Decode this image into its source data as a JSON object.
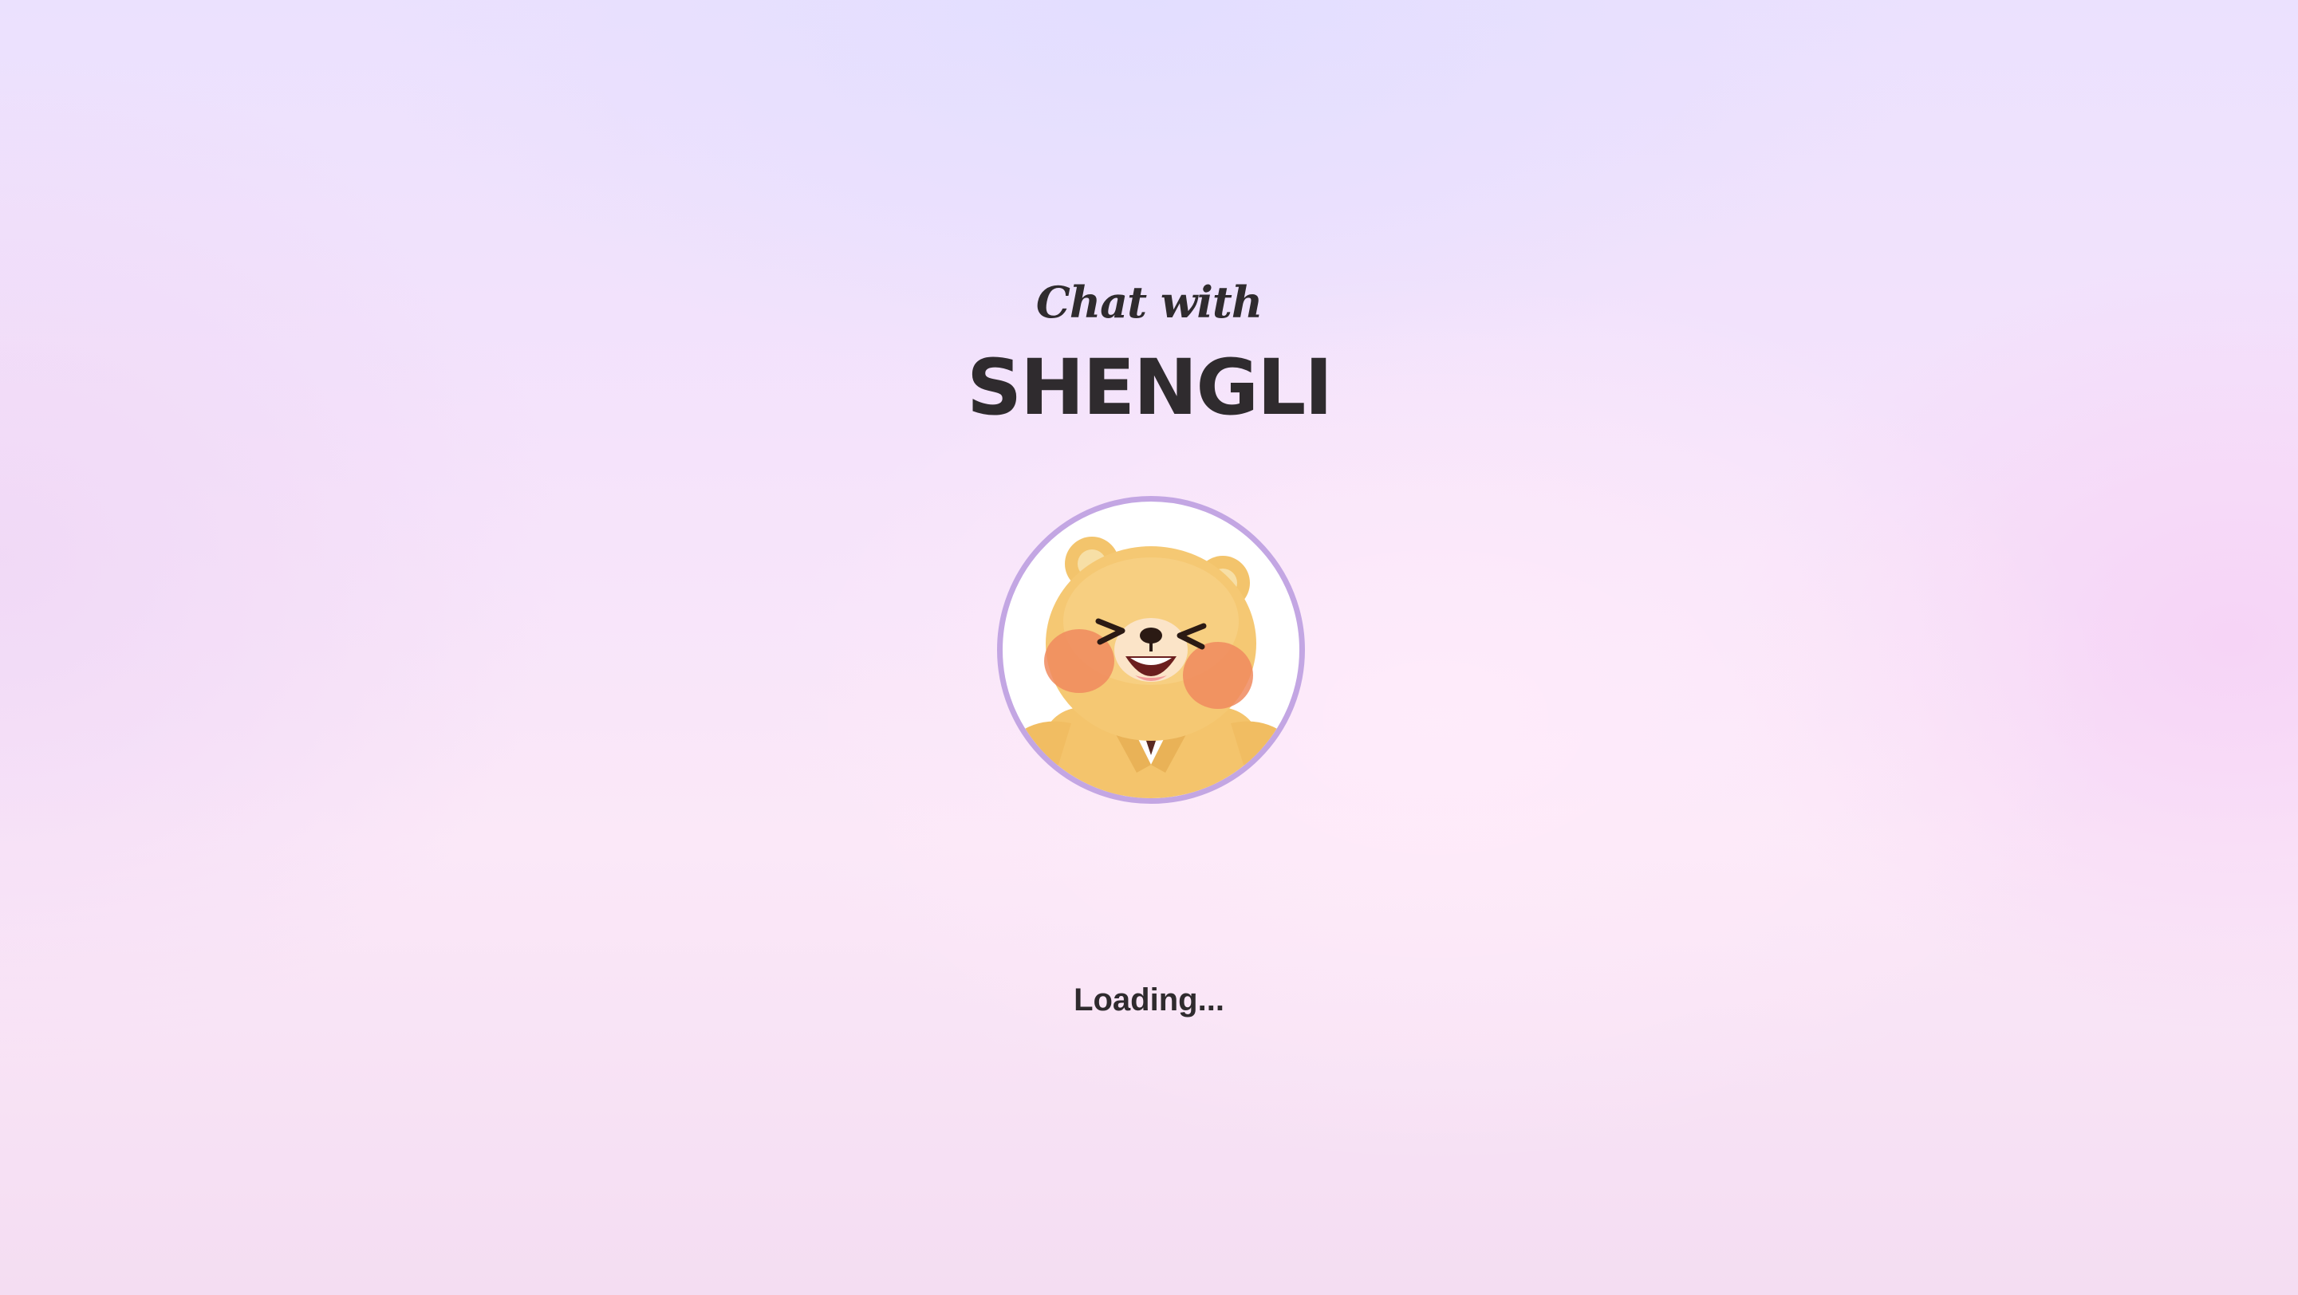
{
  "header": {
    "subtitle": "Chat with",
    "title": "SHENGLI"
  },
  "avatar": {
    "icon": "bear-mascot-avatar",
    "border_color": "#c3a6e3"
  },
  "status": {
    "text": "Loading..."
  },
  "colors": {
    "text": "#2f2b2e",
    "background_top": "#ebe1fe",
    "background_bottom": "#f4ddf2"
  }
}
